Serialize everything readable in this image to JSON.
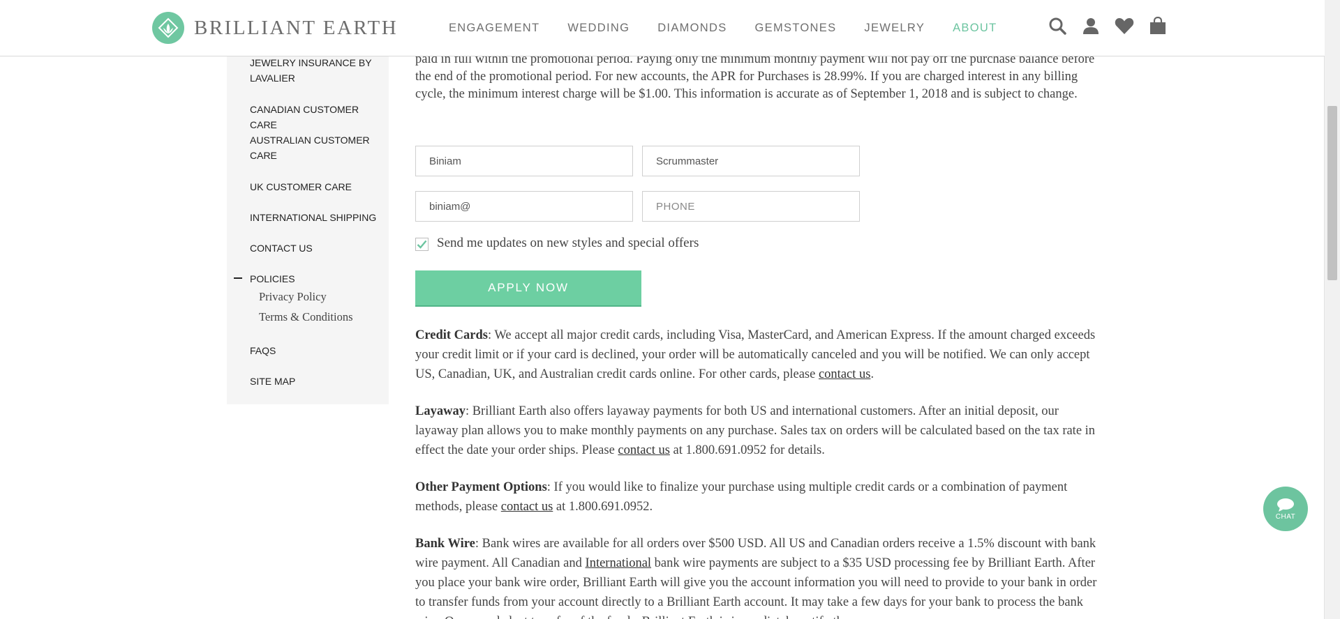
{
  "header": {
    "logo_text": "BRILLIANT EARTH",
    "nav": [
      "ENGAGEMENT",
      "WEDDING",
      "DIAMONDS",
      "GEMSTONES",
      "JEWELRY",
      "ABOUT"
    ],
    "active_nav": "ABOUT",
    "icons": [
      "search-icon",
      "account-icon",
      "wishlist-heart-icon",
      "shopping-bag-icon"
    ],
    "accent_color": "#6cc4a0"
  },
  "sidebar": {
    "items": [
      "JEWELRY INSURANCE BY LAVALIER",
      "CANADIAN CUSTOMER CARE",
      "AUSTRALIAN CUSTOMER CARE",
      "UK CUSTOMER CARE",
      "INTERNATIONAL SHIPPING",
      "CONTACT US",
      "POLICIES",
      "FAQS",
      "SITE MAP"
    ],
    "policies_sub": [
      "Privacy Policy",
      "Terms & Conditions"
    ]
  },
  "main": {
    "intro_text": "paid in full within the promotional period. Paying only the minimum monthly payment will not pay off the purchase balance before the end of the promotional period. For new accounts, the APR for Purchases is 28.99%. If you are charged interest in any billing cycle, the minimum interest charge will be $1.00. This information is accurate as of September 1, 2018 and is subject to change.",
    "form": {
      "first_name": "Biniam",
      "last_name": "Scrummaster",
      "email": "biniam@",
      "phone_placeholder": "PHONE",
      "updates_checked": true,
      "updates_label": "Send me updates on new styles and special offers",
      "apply_label": "APPLY NOW"
    },
    "credit_cards": {
      "title": "Credit Cards",
      "text": ": We accept all major credit cards, including Visa, MasterCard, and American Express. If the amount charged exceeds your credit limit or if your card is declined, your order will be automatically canceled and you will be notified. We can only accept US, Canadian, UK, and Australian credit cards online. For other cards, please ",
      "link": "contact us",
      "end": "."
    },
    "layaway": {
      "title": "Layaway",
      "text": ": Brilliant Earth also offers layaway payments for both US and international customers. After an initial deposit, our layaway plan allows you to make monthly payments on any purchase. Sales tax on orders will be calculated based on the tax rate in effect the date your order ships. Please ",
      "link": "contact us",
      "end": " at 1.800.691.0952 for details."
    },
    "other": {
      "title": "Other Payment Options",
      "text": ": If you would like to finalize your purchase using multiple credit cards or a combination of payment methods, please ",
      "link": "contact us",
      "end": " at 1.800.691.0952."
    },
    "bank_wire": {
      "title": "Bank Wire",
      "text1": ": Bank wires are available for all orders over $500 USD. All US and Canadian orders receive a 1.5% discount with bank wire payment. All Canadian and ",
      "link": "International",
      "text2": " bank wire payments are subject to a $35 USD processing fee by Brilliant Earth. After you place your bank wire order, Brilliant Earth will give you the account information you will need to provide to your bank in order to transfer funds from your account directly to a Brilliant Earth account. It may take a few days for your bank to process the bank wire. Once we deduct transfer of the funds, Brilliant Earth is immediately notify the..."
    }
  },
  "chat": {
    "label": "CHAT"
  }
}
